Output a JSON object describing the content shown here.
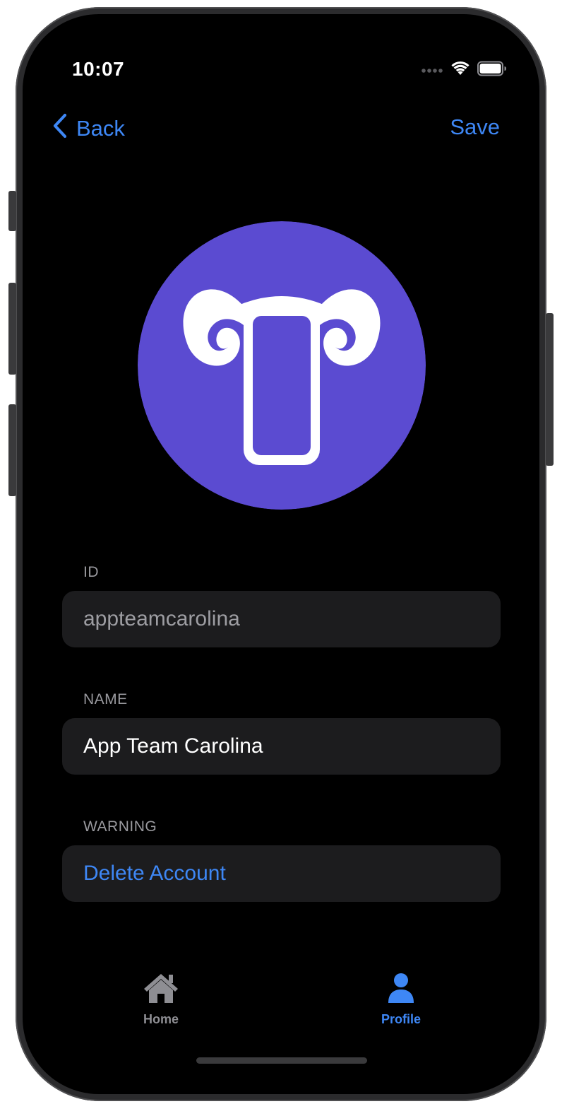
{
  "status_bar": {
    "time": "10:07",
    "signal_icon": "signal-dots-icon",
    "wifi_icon": "wifi-icon",
    "battery_icon": "battery-icon"
  },
  "nav": {
    "back_label": "Back",
    "back_icon": "chevron-left-icon",
    "save_label": "Save"
  },
  "avatar": {
    "icon": "ram-phone-logo-icon",
    "background_color": "#5b4bd1"
  },
  "sections": {
    "id": {
      "label": "ID",
      "value": "appteamcarolina"
    },
    "name": {
      "label": "NAME",
      "value": "App Team Carolina"
    },
    "warning": {
      "label": "WARNING",
      "action_label": "Delete Account"
    }
  },
  "tab_bar": {
    "items": [
      {
        "label": "Home",
        "icon": "house-icon",
        "selected": false
      },
      {
        "label": "Profile",
        "icon": "person-icon",
        "selected": true
      }
    ],
    "accent_color": "#3e87f5",
    "inactive_color": "#8e8e93"
  }
}
